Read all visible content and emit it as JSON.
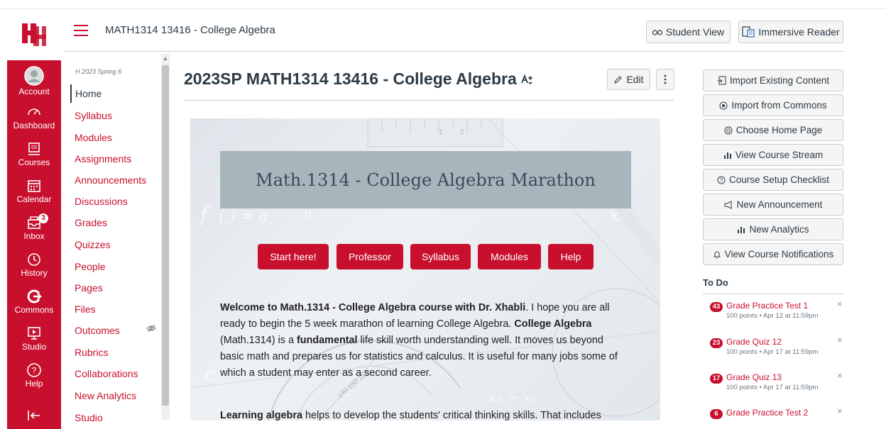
{
  "header": {
    "breadcrumb": "MATH1314 13416 - College Algebra",
    "student_view_label": "Student View",
    "immersive_reader_label": "Immersive Reader"
  },
  "global_nav": [
    {
      "label": "Account",
      "icon": "account-icon"
    },
    {
      "label": "Dashboard",
      "icon": "dashboard-icon"
    },
    {
      "label": "Courses",
      "icon": "courses-icon"
    },
    {
      "label": "Calendar",
      "icon": "calendar-icon"
    },
    {
      "label": "Inbox",
      "icon": "inbox-icon",
      "badge": "3"
    },
    {
      "label": "History",
      "icon": "history-icon"
    },
    {
      "label": "Commons",
      "icon": "commons-icon"
    },
    {
      "label": "Studio",
      "icon": "studio-icon"
    },
    {
      "label": "Help",
      "icon": "help-icon"
    }
  ],
  "course_nav": {
    "term": "H 2023 Spring 6",
    "items": [
      "Home",
      "Syllabus",
      "Modules",
      "Assignments",
      "Announcements",
      "Discussions",
      "Grades",
      "Quizzes",
      "People",
      "Pages",
      "Files",
      "Outcomes",
      "Rubrics",
      "Collaborations",
      "New Analytics",
      "Studio"
    ]
  },
  "main": {
    "title": "2023SP MATH1314 13416 - College Algebra",
    "edit_label": "Edit",
    "banner_title": "Math.1314 - College Algebra Marathon",
    "buttons": [
      "Start here!",
      "Professor",
      "Syllabus",
      "Modules",
      "Help"
    ],
    "p1": {
      "b1": "Welcome to Math.1314 - College Algebra course with Dr. Xhabli",
      "t1": ". I hope you are all ready to begin the 5 week marathon of learning College Algebra. ",
      "b2": "College Algebra",
      "t2": " (Math.1314) is a ",
      "b3": "fundamental",
      "t3": " life skill worth understanding well. It moves us beyond basic math and prepares us for statistics and calculus. It is useful for many jobs some of which a student may enter as a second career."
    },
    "p2": {
      "b1": "Learning algebra",
      "t1": " helps to develop the students' critical thinking skills. That includes"
    }
  },
  "sidebar": {
    "buttons": [
      {
        "label": "Import Existing Content",
        "icon": "import-icon"
      },
      {
        "label": "Import from Commons",
        "icon": "commons-icon"
      },
      {
        "label": "Choose Home Page",
        "icon": "home-choose-icon"
      },
      {
        "label": "View Course Stream",
        "icon": "stream-icon"
      },
      {
        "label": "Course Setup Checklist",
        "icon": "checklist-icon"
      },
      {
        "label": "New Announcement",
        "icon": "announcement-icon"
      },
      {
        "label": "New Analytics",
        "icon": "analytics-icon"
      },
      {
        "label": "View Course Notifications",
        "icon": "bell-icon"
      }
    ],
    "todo_heading": "To Do",
    "todo": [
      {
        "count": "43",
        "title": "Grade Practice Test 1",
        "meta": "100 points • Apr 12 at 11:59pm"
      },
      {
        "count": "23",
        "title": "Grade Quiz 12",
        "meta": "100 points • Apr 17 at 11:59pm"
      },
      {
        "count": "17",
        "title": "Grade Quiz 13",
        "meta": "100 points • Apr 17 at 11:59pm"
      },
      {
        "count": "6",
        "title": "Grade Practice Test 2",
        "meta": ""
      }
    ]
  },
  "colors": {
    "brand": "#c8102e",
    "text": "#2d3b45",
    "banner": "#a9b5bc"
  }
}
